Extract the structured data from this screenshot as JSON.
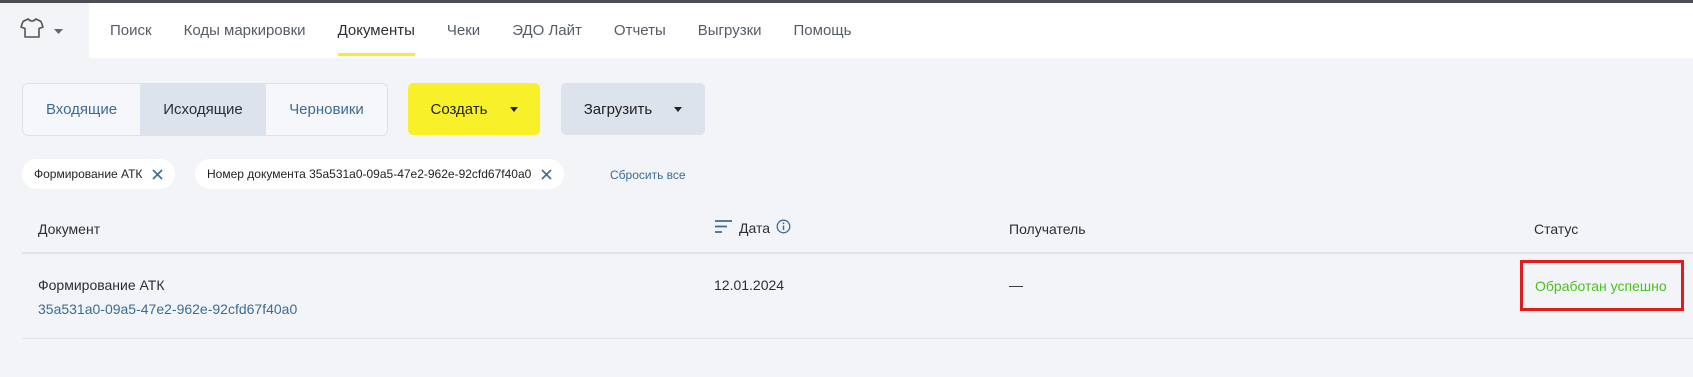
{
  "nav": {
    "brand_icon": "tshirt-icon",
    "items": [
      {
        "label": "Поиск"
      },
      {
        "label": "Коды маркировки"
      },
      {
        "label": "Документы"
      },
      {
        "label": "Чеки"
      },
      {
        "label": "ЭДО Лайт"
      },
      {
        "label": "Отчеты"
      },
      {
        "label": "Выгрузки"
      },
      {
        "label": "Помощь"
      }
    ],
    "active": "Документы"
  },
  "tabs": {
    "incoming": "Входящие",
    "outgoing": "Исходящие",
    "drafts": "Черновики",
    "selected": "Исходящие"
  },
  "actions": {
    "create": "Создать",
    "upload": "Загрузить"
  },
  "filters": {
    "chips": [
      {
        "label": "Формирование АТК"
      },
      {
        "label": "Номер документа 35a531a0-09a5-47e2-962e-92cfd67f40a0"
      }
    ],
    "reset": "Сбросить все"
  },
  "table": {
    "columns": {
      "document": "Документ",
      "date": "Дата",
      "recipient": "Получатель",
      "status": "Статус"
    },
    "rows": [
      {
        "doc_type": "Формирование АТК",
        "doc_id": "35a531a0-09a5-47e2-962e-92cfd67f40a0",
        "date": "12.01.2024",
        "recipient": "—",
        "status": "Обработан успешно"
      }
    ]
  },
  "colors": {
    "accent_yellow": "#f8f129",
    "link_blue": "#3b6c96",
    "status_green": "#4bbf20",
    "highlight_red": "#e31b1b"
  }
}
